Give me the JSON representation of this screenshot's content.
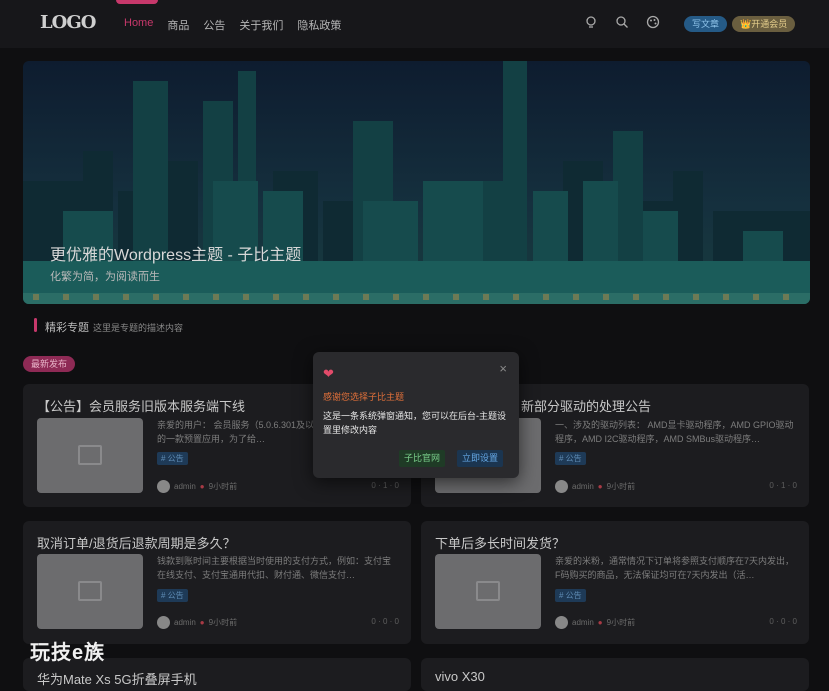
{
  "header": {
    "logo": "LOGO",
    "nav": [
      "Home",
      "商品",
      "公告",
      "关于我们",
      "隐私政策"
    ],
    "icons": [
      "bulb-icon",
      "search-icon",
      "palette-icon"
    ],
    "write_btn": "写文章",
    "vip_btn": "👑开通会员"
  },
  "banner": {
    "title": "更优雅的Wordpress主题 - 子比主题",
    "subtitle": "化繁为简，为阅读而生"
  },
  "section": {
    "title": "精彩专题",
    "desc": "这里是专题的描述内容"
  },
  "latest_badge": "最新发布",
  "cards": [
    {
      "title": "【公告】会员服务旧版本服务端下线",
      "excerpt": "亲爱的用户：  会员服务（5.0.6.301及以下版本）华为手机中的一款预置应用，为了给…",
      "tag": "# 公告",
      "author": "admin",
      "time": "9小时前",
      "stats": "0 · 1 · 0"
    },
    {
      "title": "新部分驱动的处理公告",
      "excerpt": "一、涉及的驱动列表： AMD显卡驱动程序，AMD GPIO驱动程序，AMD I2C驱动程序，AMD SMBus驱动程序…",
      "tag": "# 公告",
      "author": "admin",
      "time": "9小时前",
      "stats": "0 · 1 · 0"
    },
    {
      "title": "取消订单/退货后退款周期是多久？",
      "excerpt": "钱款到账时间主要根据当时使用的支付方式，例如：支付宝在线支付、支付宝通用代扣、财付通、微信支付…",
      "tag": "# 公告",
      "author": "admin",
      "time": "9小时前",
      "stats": "0 · 0 · 0"
    },
    {
      "title": "下单后多长时间发货？",
      "excerpt": "亲爱的米粉，通常情况下订单将参照支付顺序在7天内发出，F码购买的商品，无法保证均可在7天内发出（活…",
      "tag": "# 公告",
      "author": "admin",
      "time": "9小时前",
      "stats": "0 · 0 · 0"
    },
    {
      "title": "华为Mate Xs 5G折叠屏手机"
    },
    {
      "title": "vivo X30"
    }
  ],
  "modal": {
    "title": "感谢您选择子比主题",
    "body": "这是一条系统弹窗通知，您可以在后台-主题设置里修改内容",
    "btn1": "子比官网",
    "btn2": "立即设置",
    "close": "×"
  },
  "watermark": "玩技e族",
  "colors": {
    "accent": "#c7386b",
    "modal_title": "#e0703a"
  }
}
